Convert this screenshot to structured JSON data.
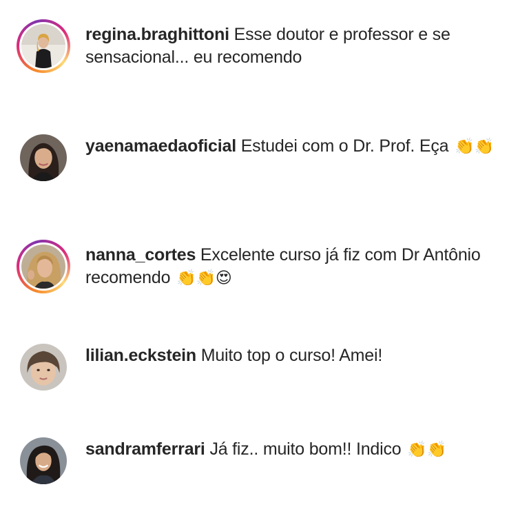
{
  "comments": [
    {
      "username": "regina.braghittoni",
      "text": "Esse doutor e professor e se sensacional... eu recomendo",
      "emojis": "",
      "has_story_ring": true,
      "avatar_icon": "woman-standing-avatar"
    },
    {
      "username": "yaenamaedaoficial",
      "text": "Estudei com o Dr. Prof. Eça",
      "emojis": "👏👏",
      "has_story_ring": false,
      "avatar_icon": "woman-long-hair-avatar"
    },
    {
      "username": "nanna_cortes",
      "text": "Excelente curso já fiz com Dr Antônio recomendo",
      "emojis": "👏👏😍",
      "has_story_ring": true,
      "avatar_icon": "blonde-woman-avatar"
    },
    {
      "username": "lilian.eckstein",
      "text": "Muito top o curso! Amei!",
      "emojis": "",
      "has_story_ring": false,
      "avatar_icon": "woman-face-avatar"
    },
    {
      "username": "sandramferrari",
      "text": "Já fiz.. muito bom!! Indico",
      "emojis": "👏👏",
      "has_story_ring": false,
      "avatar_icon": "woman-smiling-avatar"
    }
  ],
  "colors": {
    "text": "#262626",
    "background": "#ffffff",
    "story_ring": "#dd2a7b"
  }
}
